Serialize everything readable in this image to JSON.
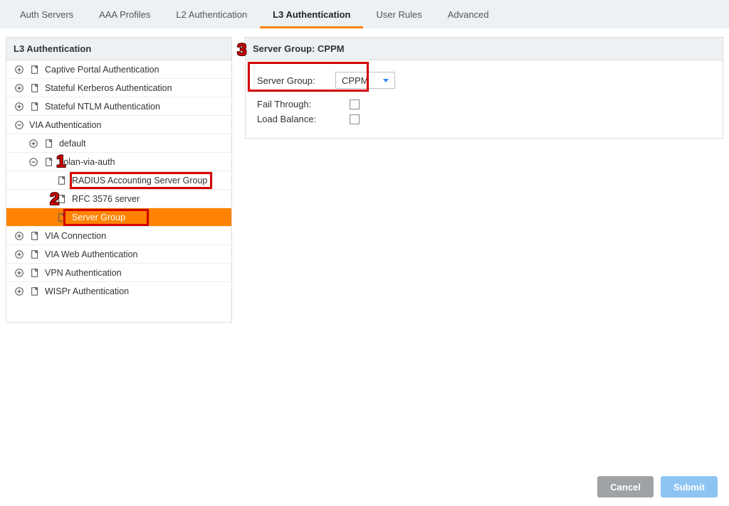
{
  "tabs": [
    {
      "label": "Auth Servers",
      "active": false
    },
    {
      "label": "AAA Profiles",
      "active": false
    },
    {
      "label": "L2 Authentication",
      "active": false
    },
    {
      "label": "L3 Authentication",
      "active": true
    },
    {
      "label": "User Rules",
      "active": false
    },
    {
      "label": "Advanced",
      "active": false
    }
  ],
  "left": {
    "title": "L3 Authentication",
    "items": [
      {
        "label": "Captive Portal Authentication",
        "expand": "plus",
        "icon": true,
        "indent": 0
      },
      {
        "label": "Stateful Kerberos Authentication",
        "expand": "plus",
        "icon": true,
        "indent": 0
      },
      {
        "label": "Stateful NTLM Authentication",
        "expand": "plus",
        "icon": true,
        "indent": 0
      },
      {
        "label": "VIA Authentication",
        "expand": "minus",
        "icon": false,
        "indent": 0
      },
      {
        "label": "default",
        "expand": "plus",
        "icon": true,
        "indent": 1
      },
      {
        "label": "flolan-via-auth",
        "expand": "minus",
        "icon": true,
        "indent": 1
      },
      {
        "label": "RADIUS Accounting Server Group",
        "expand": "none",
        "icon": true,
        "indent": 3
      },
      {
        "label": "RFC 3576 server",
        "expand": "none",
        "icon": true,
        "indent": 3
      },
      {
        "label": "Server Group",
        "expand": "none",
        "icon": true,
        "indent": 3,
        "selected": true
      },
      {
        "label": "VIA Connection",
        "expand": "plus",
        "icon": true,
        "indent": 0
      },
      {
        "label": "VIA Web Authentication",
        "expand": "plus",
        "icon": true,
        "indent": 0
      },
      {
        "label": "VPN Authentication",
        "expand": "plus",
        "icon": true,
        "indent": 0
      },
      {
        "label": "WISPr Authentication",
        "expand": "plus",
        "icon": true,
        "indent": 0
      }
    ]
  },
  "right": {
    "title": "Server Group: CPPM",
    "server_group_label": "Server Group:",
    "server_group_value": "CPPM",
    "fail_through_label": "Fail Through:",
    "load_balance_label": "Load Balance:"
  },
  "buttons": {
    "cancel": "Cancel",
    "submit": "Submit"
  },
  "callouts": {
    "c1": "1",
    "c2": "2",
    "c3": "3"
  }
}
